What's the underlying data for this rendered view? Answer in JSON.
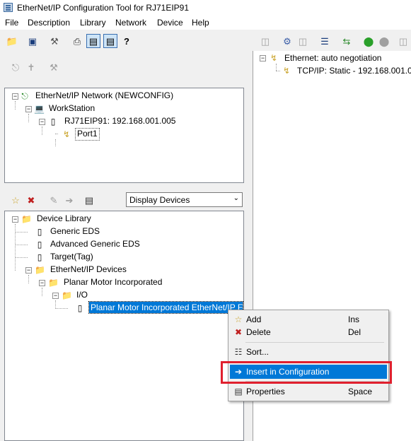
{
  "window": {
    "title": "EtherNet/IP Configuration Tool for RJ71EIP91"
  },
  "menu": [
    "File",
    "Description",
    "Library",
    "Network",
    "Device",
    "Help"
  ],
  "network_tree": {
    "root": "EtherNet/IP Network (NEWCONFIG)",
    "workstation": "WorkStation",
    "module": "RJ71EIP91: 192.168.001.005",
    "port": "Port1"
  },
  "display_combo": {
    "selected": "Display Devices"
  },
  "device_library": {
    "root": "Device Library",
    "generic_eds": "Generic EDS",
    "advanced_eds": "Advanced Generic EDS",
    "target_tag": "Target(Tag)",
    "ethernet_devices": "EtherNet/IP Devices",
    "vendor": "Planar Motor Incorporated",
    "io": "I/O",
    "device": "Planar Motor Incorporated EtherNet/IP F"
  },
  "right_tree": {
    "ethernet": "Ethernet: auto negotiation",
    "tcpip": "TCP/IP: Static - 192.168.001.005"
  },
  "context_menu": {
    "add": "Add",
    "add_shortcut": "Ins",
    "delete": "Delete",
    "delete_shortcut": "Del",
    "sort": "Sort...",
    "insert": "Insert in Configuration",
    "properties": "Properties",
    "properties_shortcut": "Space"
  }
}
